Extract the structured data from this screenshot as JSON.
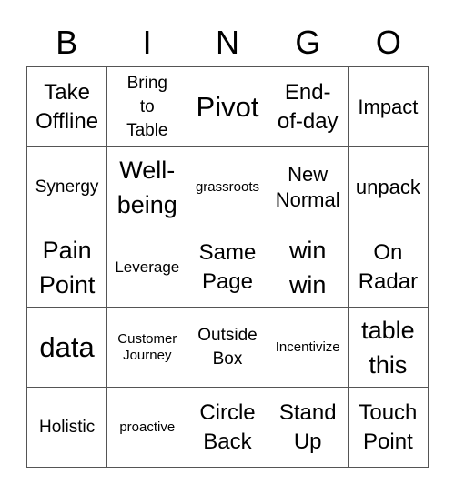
{
  "header": {
    "letters": [
      "B",
      "I",
      "N",
      "G",
      "O"
    ]
  },
  "grid": {
    "rows": [
      [
        "Take\nOffline",
        "Bring\nto\nTable",
        "Pivot",
        "End-\nof-day",
        "Impact"
      ],
      [
        "Synergy",
        "Well-\nbeing",
        "grassroots",
        "New\nNormal",
        "unpack"
      ],
      [
        "Pain\nPoint",
        "Leverage",
        "Same\nPage",
        "win\nwin",
        "On\nRadar"
      ],
      [
        "data",
        "Customer\nJourney",
        "Outside\nBox",
        "Incentivize",
        "table\nthis"
      ],
      [
        "Holistic",
        "proactive",
        "Circle\nBack",
        "Stand\nUp",
        "Touch\nPoint"
      ]
    ]
  }
}
